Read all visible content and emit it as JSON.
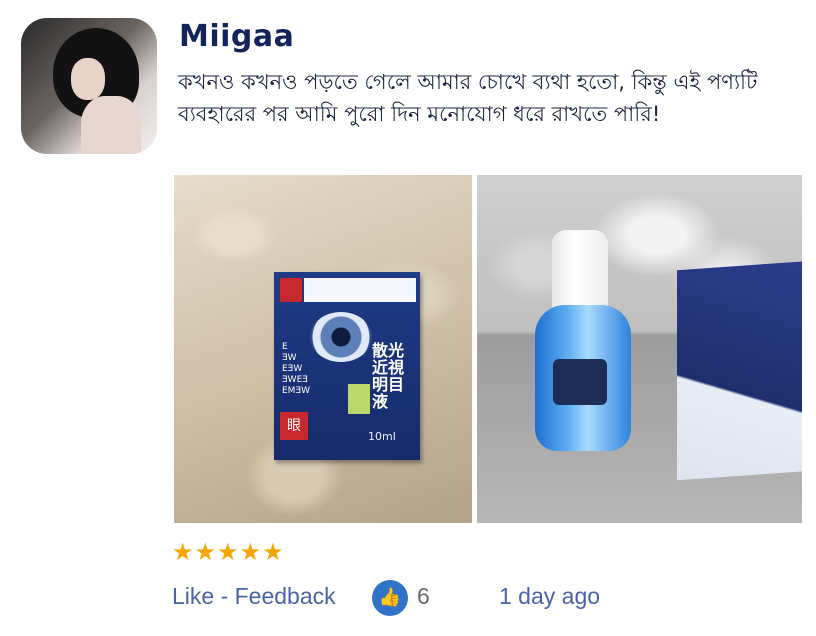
{
  "user": {
    "name": "Miigaa"
  },
  "review": {
    "text": "কখনও কখনও পড়তে গেলে আমার চোখে ব্যথা হতো, কিন্তু এই পণ্যটি ব্যবহারের পর আমি পুরো দিন মনোযোগ ধরে রাখতে পারি!"
  },
  "rating": {
    "stars": 5,
    "max": 5
  },
  "footer": {
    "like_feedback": "Like - Feedback",
    "like_count": "6",
    "time_ago": "1 day ago"
  },
  "colors": {
    "star": "#f6a609",
    "link": "#4a63a9",
    "username": "#13245a",
    "like_badge": "#2f74c8"
  },
  "icons": {
    "like": "thumbs-up-icon",
    "star": "star-icon"
  }
}
